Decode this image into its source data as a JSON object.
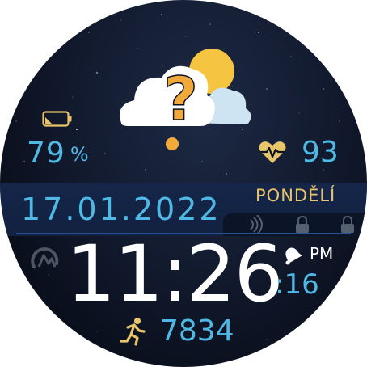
{
  "battery": {
    "value": "79",
    "unit": "%",
    "icon": "battery-low-icon",
    "icon_color": "#e8c56a"
  },
  "heart_rate": {
    "value": "93",
    "icon": "heart-rate-icon",
    "icon_color": "#e8c56a"
  },
  "weather": {
    "icon": "weather-unknown-icon",
    "question_color": "#f2a93b",
    "sun_color": "#f5c542"
  },
  "date": {
    "text": "17.01.2022",
    "weekday": "PONDĚLÍ"
  },
  "time": {
    "hours_minutes": "11:26",
    "seconds": ":16",
    "ampm": "PM"
  },
  "steps": {
    "value": "7834",
    "icon": "running-icon"
  },
  "status_icons": [
    "nfc-icon",
    "lock-icon",
    "lock-icon"
  ],
  "colors": {
    "accent_blue": "#4fb9e6",
    "accent_gold": "#e8c56a",
    "time_white": "#ffffff"
  }
}
